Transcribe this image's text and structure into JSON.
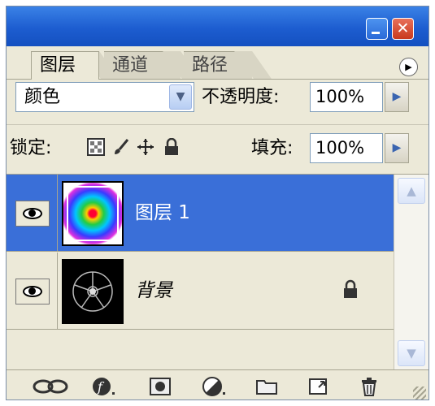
{
  "tabs": [
    {
      "label": "图层",
      "active": true
    },
    {
      "label": "通道",
      "active": false
    },
    {
      "label": "路径",
      "active": false
    }
  ],
  "blend": {
    "mode": "颜色",
    "opacity_label": "不透明度:",
    "opacity_value": "100%"
  },
  "lock": {
    "label": "锁定:",
    "fill_label": "填充:",
    "fill_value": "100%"
  },
  "layers": [
    {
      "name": "图层 1",
      "selected": true,
      "visible": true
    },
    {
      "name": "背景",
      "selected": false,
      "visible": true,
      "locked": true
    }
  ],
  "colors": {
    "selection": "#3a6fd8",
    "panel": "#ece9d8",
    "titlebar": "#1d5dd0"
  },
  "bottom_icons": [
    "link-layers-icon",
    "layer-style-icon",
    "layer-mask-icon",
    "adjustment-layer-icon",
    "new-group-icon",
    "new-layer-icon",
    "delete-layer-icon"
  ]
}
